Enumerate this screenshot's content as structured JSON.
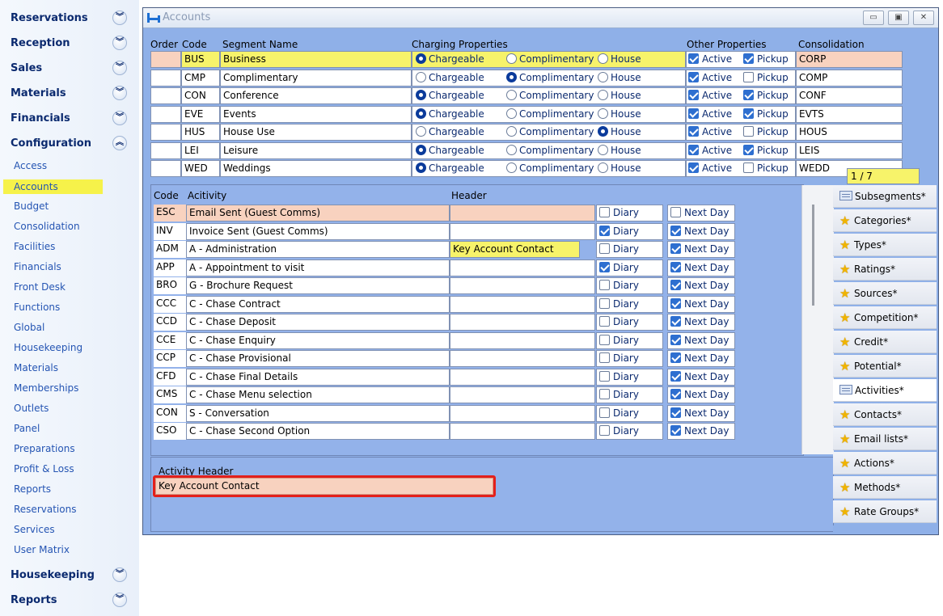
{
  "nav": {
    "groups_top": [
      {
        "label": "Reservations"
      },
      {
        "label": "Reception"
      },
      {
        "label": "Sales"
      },
      {
        "label": "Materials"
      },
      {
        "label": "Financials"
      },
      {
        "label": "Configuration"
      }
    ],
    "items": [
      {
        "label": "Access"
      },
      {
        "label": "Accounts",
        "active": true
      },
      {
        "label": "Budget"
      },
      {
        "label": "Consolidation"
      },
      {
        "label": "Facilities"
      },
      {
        "label": "Financials"
      },
      {
        "label": "Front Desk"
      },
      {
        "label": "Functions"
      },
      {
        "label": "Global"
      },
      {
        "label": "Housekeeping"
      },
      {
        "label": "Materials"
      },
      {
        "label": "Memberships"
      },
      {
        "label": "Outlets"
      },
      {
        "label": "Panel"
      },
      {
        "label": "Preparations"
      },
      {
        "label": "Profit & Loss"
      },
      {
        "label": "Reports"
      },
      {
        "label": "Reservations"
      },
      {
        "label": "Services"
      },
      {
        "label": "User Matrix"
      }
    ],
    "groups_bottom": [
      {
        "label": "Housekeeping"
      },
      {
        "label": "Reports"
      }
    ]
  },
  "window": {
    "title": "Accounts",
    "minimize_icon": "minimize-icon",
    "restore_icon": "restore-icon",
    "close_icon": "close-icon"
  },
  "segments": {
    "headers": {
      "order": "Order",
      "code": "Code",
      "name": "Segment Name",
      "charging": "Charging Properties",
      "other": "Other Properties",
      "consolidation": "Consolidation"
    },
    "option_labels": {
      "chargeable": "Chargeable",
      "complimentary": "Complimentary",
      "house": "House",
      "active": "Active",
      "pickup": "Pickup"
    },
    "rows": [
      {
        "order": "",
        "code": "BUS",
        "name": "Business",
        "charging": "Chargeable",
        "active": true,
        "pickup": true,
        "consolidation": "CORP"
      },
      {
        "order": "",
        "code": "CMP",
        "name": "Complimentary",
        "charging": "Complimentary",
        "active": true,
        "pickup": false,
        "consolidation": "COMP"
      },
      {
        "order": "",
        "code": "CON",
        "name": "Conference",
        "charging": "Chargeable",
        "active": true,
        "pickup": true,
        "consolidation": "CONF"
      },
      {
        "order": "",
        "code": "EVE",
        "name": "Events",
        "charging": "Chargeable",
        "active": true,
        "pickup": true,
        "consolidation": "EVTS"
      },
      {
        "order": "",
        "code": "HUS",
        "name": "House Use",
        "charging": "House",
        "active": true,
        "pickup": false,
        "consolidation": "HOUS"
      },
      {
        "order": "",
        "code": "LEI",
        "name": "Leisure",
        "charging": "Chargeable",
        "active": true,
        "pickup": true,
        "consolidation": "LEIS"
      },
      {
        "order": "",
        "code": "WED",
        "name": "Weddings",
        "charging": "Chargeable",
        "active": true,
        "pickup": false,
        "consolidation": "WEDD"
      }
    ],
    "record_counter": "1 / 7"
  },
  "activities": {
    "headers": {
      "code": "Code",
      "activity": "Acitivity",
      "header": "Header"
    },
    "option_labels": {
      "diary": "Diary",
      "next_day": "Next Day"
    },
    "rows": [
      {
        "code": "ESC",
        "activity": "Email Sent (Guest Comms)",
        "header": "",
        "diary": false,
        "next_day": false
      },
      {
        "code": "INV",
        "activity": "Invoice Sent (Guest Comms)",
        "header": "",
        "diary": true,
        "next_day": true
      },
      {
        "code": "ADM",
        "activity": "A - Administration",
        "header": "Key Account Contact",
        "diary": false,
        "next_day": true
      },
      {
        "code": "APP",
        "activity": "A - Appointment to visit",
        "header": "",
        "diary": true,
        "next_day": true
      },
      {
        "code": "BRO",
        "activity": "G - Brochure Request",
        "header": "",
        "diary": false,
        "next_day": true
      },
      {
        "code": "CCC",
        "activity": "C - Chase Contract",
        "header": "",
        "diary": false,
        "next_day": true
      },
      {
        "code": "CCD",
        "activity": "C - Chase Deposit",
        "header": "",
        "diary": false,
        "next_day": true
      },
      {
        "code": "CCE",
        "activity": "C - Chase Enquiry",
        "header": "",
        "diary": false,
        "next_day": true
      },
      {
        "code": "CCP",
        "activity": "C - Chase Provisional",
        "header": "",
        "diary": false,
        "next_day": true
      },
      {
        "code": "CFD",
        "activity": "C - Chase Final Details",
        "header": "",
        "diary": false,
        "next_day": true
      },
      {
        "code": "CMS",
        "activity": "C - Chase Menu selection",
        "header": "",
        "diary": false,
        "next_day": true
      },
      {
        "code": "CON",
        "activity": "S - Conversation",
        "header": "",
        "diary": false,
        "next_day": true
      },
      {
        "code": "CSO",
        "activity": "C - Chase Second Option",
        "header": "",
        "diary": false,
        "next_day": true
      }
    ]
  },
  "activity_header": {
    "label": "Activity Header",
    "value": "Key Account Contact",
    "highlight_color": "#e3201b"
  },
  "right_tabs": [
    {
      "label": "Subsegments*",
      "icon": "note-icon"
    },
    {
      "label": "Categories*",
      "icon": "star-icon"
    },
    {
      "label": "Types*",
      "icon": "star-icon"
    },
    {
      "label": "Ratings*",
      "icon": "star-icon"
    },
    {
      "label": "Sources*",
      "icon": "star-icon"
    },
    {
      "label": "Competition*",
      "icon": "star-icon"
    },
    {
      "label": "Credit*",
      "icon": "star-icon"
    },
    {
      "label": "Potential*",
      "icon": "star-icon"
    },
    {
      "label": "Activities*",
      "icon": "note-icon",
      "active": true
    },
    {
      "label": "Contacts*",
      "icon": "star-icon"
    },
    {
      "label": "Email lists*",
      "icon": "star-icon"
    },
    {
      "label": "Actions*",
      "icon": "star-icon"
    },
    {
      "label": "Methods*",
      "icon": "star-icon"
    },
    {
      "label": "Rate Groups*",
      "icon": "star-icon"
    }
  ]
}
